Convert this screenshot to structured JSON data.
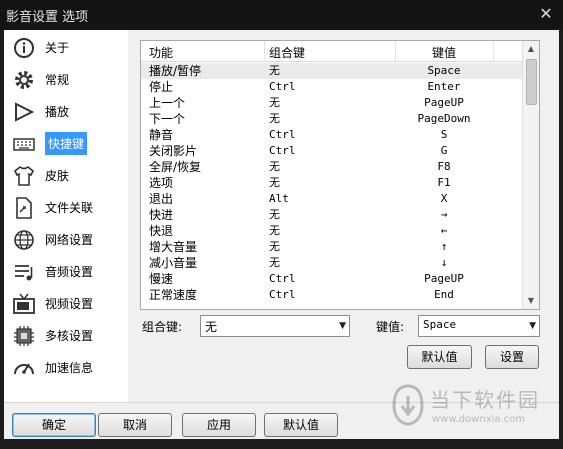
{
  "window": {
    "title": "影音设置 选项",
    "close_glyph": "✕"
  },
  "sidebar": {
    "items": [
      {
        "label": "关于",
        "icon": "info-icon",
        "active": false
      },
      {
        "label": "常规",
        "icon": "gear-icon",
        "active": false
      },
      {
        "label": "播放",
        "icon": "play-icon",
        "active": false
      },
      {
        "label": "快捷键",
        "icon": "keyboard-icon",
        "active": true
      },
      {
        "label": "皮肤",
        "icon": "shirt-icon",
        "active": false
      },
      {
        "label": "文件关联",
        "icon": "file-link-icon",
        "active": false
      },
      {
        "label": "网络设置",
        "icon": "globe-icon",
        "active": false
      },
      {
        "label": "音频设置",
        "icon": "audio-icon",
        "active": false
      },
      {
        "label": "视频设置",
        "icon": "tv-icon",
        "active": false
      },
      {
        "label": "多核设置",
        "icon": "cpu-icon",
        "active": false
      },
      {
        "label": "加速信息",
        "icon": "speedometer-icon",
        "active": false
      }
    ]
  },
  "shortcuts": {
    "headers": [
      "功能",
      "组合键",
      "键值"
    ],
    "rows": [
      [
        "播放/暂停",
        "无",
        "Space"
      ],
      [
        "停止",
        "Ctrl",
        "Enter"
      ],
      [
        "上一个",
        "无",
        "PageUP"
      ],
      [
        "下一个",
        "无",
        "PageDown"
      ],
      [
        "静音",
        "Ctrl",
        "S"
      ],
      [
        "关闭影片",
        "Ctrl",
        "G"
      ],
      [
        "全屏/恢复",
        "无",
        "F8"
      ],
      [
        "选项",
        "无",
        "F1"
      ],
      [
        "退出",
        "Alt",
        "X"
      ],
      [
        "快进",
        "无",
        "→"
      ],
      [
        "快退",
        "无",
        "←"
      ],
      [
        "增大音量",
        "无",
        "↑"
      ],
      [
        "减小音量",
        "无",
        "↓"
      ],
      [
        "慢速",
        "Ctrl",
        "PageUP"
      ],
      [
        "正常速度",
        "Ctrl",
        "End"
      ]
    ],
    "selected_index": 0
  },
  "editor": {
    "combo_label": "组合键:",
    "combo_value": "无",
    "key_label": "键值:",
    "key_value": "Space",
    "default_button": "默认值",
    "set_button": "设置"
  },
  "footer": {
    "ok": "确定",
    "cancel": "取消",
    "apply": "应用",
    "default": "默认值"
  },
  "watermark": {
    "text": "当下软件园",
    "url": "www.downxia.com"
  },
  "colors": {
    "selection": "#3399ff",
    "titlebar": "#141414"
  }
}
